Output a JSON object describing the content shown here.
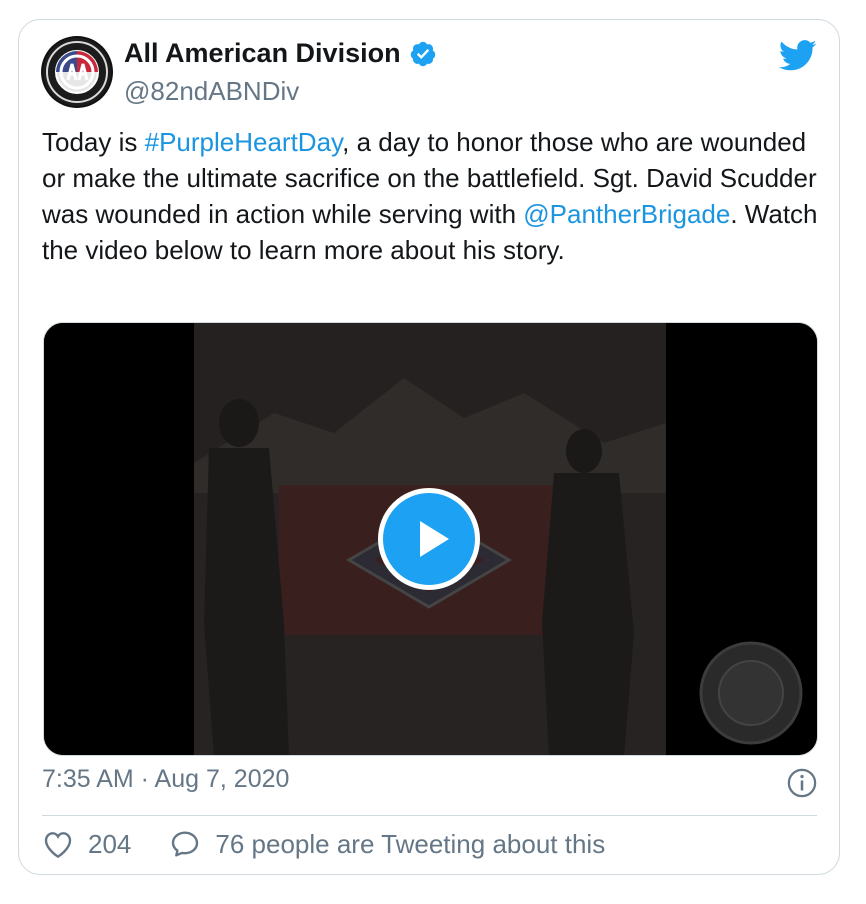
{
  "tweet": {
    "author_name": "All American Division",
    "author_handle": "@82ndABNDiv",
    "text_parts": {
      "p1": "Today is ",
      "hashtag": "#PurpleHeartDay",
      "p2": ", a day to honor those who are wounded or make the ultimate sacrifice on the battlefield. Sgt. David Scudder was wounded in action while serving with ",
      "mention": "@PantherBrigade",
      "p3": ". Watch the video below to learn more about his story."
    },
    "timestamp": "7:35 AM · Aug 7, 2020",
    "likes": "204",
    "replies_label": "76 people are Tweeting about this"
  },
  "icons": {
    "verified": "verified-badge-icon",
    "twitter": "twitter-bird-icon",
    "play": "play-icon",
    "info": "info-icon",
    "like": "heart-icon",
    "reply": "speech-bubble-icon"
  },
  "colors": {
    "accent": "#1da1f2",
    "link": "#1b95e0",
    "muted": "#657786",
    "border": "#cfd9de"
  }
}
